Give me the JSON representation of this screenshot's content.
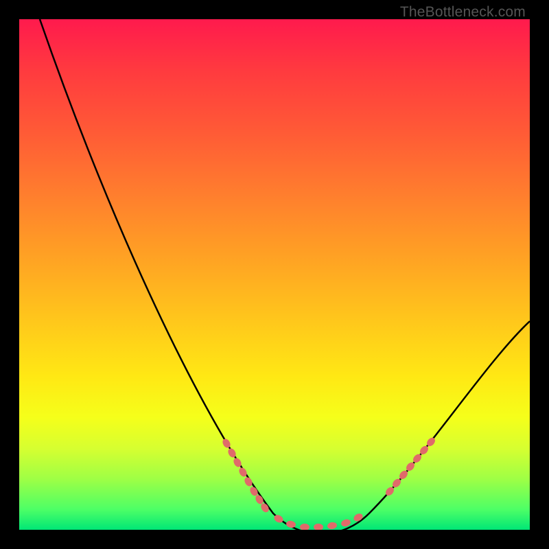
{
  "watermark": "TheBottleneck.com",
  "chart_data": {
    "type": "line",
    "title": "",
    "xlabel": "",
    "ylabel": "",
    "xlim": [
      0,
      100
    ],
    "ylim": [
      0,
      100
    ],
    "grid": false,
    "series": [
      {
        "name": "curve",
        "x": [
          4,
          8,
          12,
          16,
          20,
          24,
          28,
          32,
          36,
          40,
          44,
          48,
          52,
          56,
          60,
          64,
          68,
          72,
          76,
          80,
          84,
          88,
          92,
          96,
          100
        ],
        "y": [
          100,
          93,
          85,
          78,
          70,
          62,
          54,
          46,
          38,
          30,
          22,
          14,
          7,
          3,
          1,
          1,
          3,
          8,
          14,
          22,
          30,
          38,
          46,
          53,
          59
        ]
      }
    ],
    "markers": {
      "left_cluster_x_range": [
        40,
        54
      ],
      "right_cluster_x_range": [
        68,
        76
      ],
      "bottom_cluster_x_range": [
        54,
        68
      ],
      "marker_color": "#e46a6a"
    },
    "colors": {
      "background_top": "#ff1a4d",
      "background_bottom": "#00e676",
      "curve": "#000000",
      "marker": "#e46a6a",
      "frame": "#000000"
    }
  }
}
